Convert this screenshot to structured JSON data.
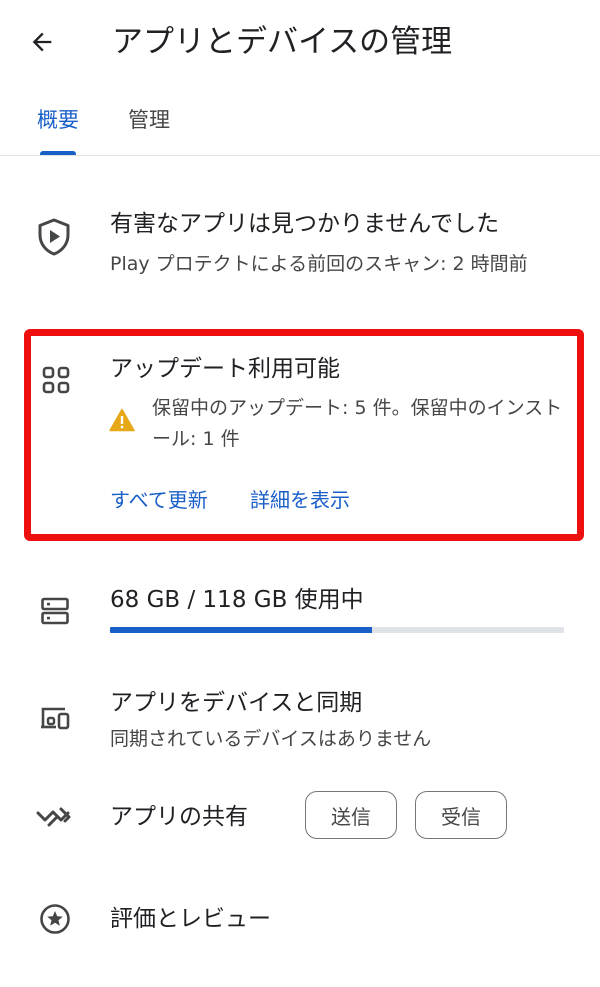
{
  "header": {
    "title": "アプリとデバイスの管理",
    "back_icon": "arrow-back-icon"
  },
  "tabs": [
    {
      "label": "概要",
      "selected": true
    },
    {
      "label": "管理",
      "selected": false
    }
  ],
  "protect": {
    "icon": "play-protect-shield-icon",
    "title": "有害なアプリは見つかりませんでした",
    "subtitle": "Play プロテクトによる前回のスキャン: 2 時間前"
  },
  "updates": {
    "icon": "apps-grid-icon",
    "title": "アップデート利用可能",
    "warning_icon": "warning-icon",
    "subtitle": "保留中のアップデート: 5 件。保留中のインストール: 1 件",
    "update_all_label": "すべて更新",
    "details_label": "詳細を表示",
    "highlight_color": "#ee0f0f"
  },
  "storage": {
    "icon": "storage-icon",
    "text": "68 GB / 118 GB 使用中",
    "used_fraction": 0.576
  },
  "sync": {
    "icon": "devices-icon",
    "title": "アプリをデバイスと同期",
    "subtitle": "同期されているデバイスはありません"
  },
  "share": {
    "icon": "nearby-share-icon",
    "title": "アプリの共有",
    "send_label": "送信",
    "receive_label": "受信"
  },
  "ratings": {
    "icon": "star-circle-icon",
    "title": "評価とレビュー"
  },
  "colors": {
    "accent": "#1a5fc8",
    "warning": "#e6a817",
    "text_primary": "#202124",
    "text_secondary": "#444746"
  }
}
